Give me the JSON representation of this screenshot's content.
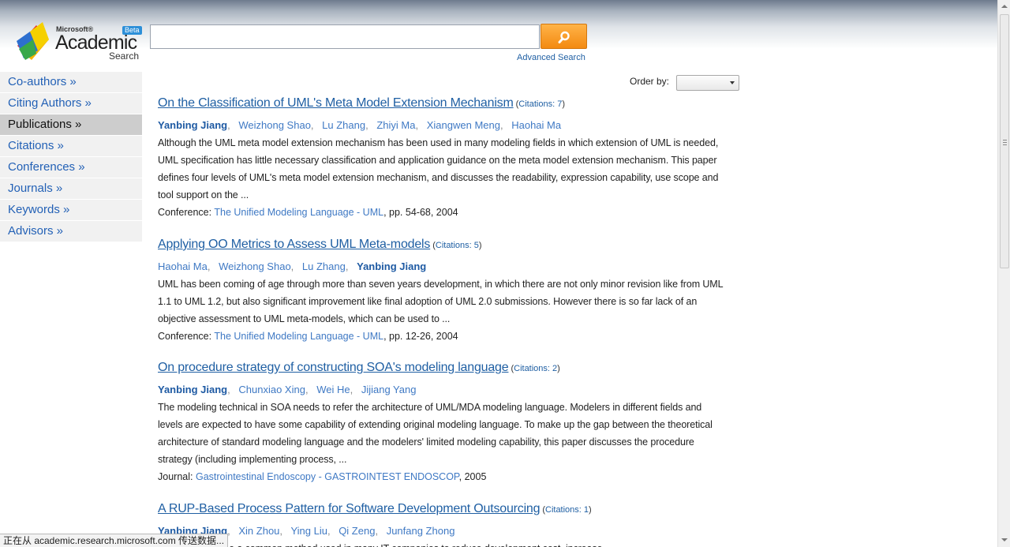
{
  "header": {
    "logo": {
      "microsoft_text": "Microsoft®",
      "academic_text": "Academic",
      "search_text": "Search",
      "beta_text": "Beta"
    },
    "search": {
      "value": "",
      "placeholder": "",
      "button_icon": "search-magnifier-icon"
    },
    "advanced_search": "Advanced Search"
  },
  "sidebar": {
    "items": [
      {
        "label": "Co-authors »",
        "active": false
      },
      {
        "label": "Citing Authors »",
        "active": false
      },
      {
        "label": "Publications »",
        "active": true
      },
      {
        "label": "Citations »",
        "active": false
      },
      {
        "label": "Conferences »",
        "active": false
      },
      {
        "label": "Journals »",
        "active": false
      },
      {
        "label": "Keywords »",
        "active": false
      },
      {
        "label": "Advisors »",
        "active": false
      }
    ]
  },
  "order": {
    "label": "Order by:",
    "selected": ""
  },
  "publications": [
    {
      "title": "On the Classification of UML's Meta Model Extension Mechanism",
      "citations_open": "(",
      "citations": "Citations: 7",
      "citations_close": ")",
      "authors": [
        "Yanbing Jiang",
        "Weizhong Shao",
        "Lu Zhang",
        "Zhiyi Ma",
        "Xiangwen Meng",
        "Haohai Ma"
      ],
      "abstract": "Although the UML meta model extension mechanism has been used in many modeling fields in which extension of UML is needed, UML specification has little necessary classification and application guidance on the meta model extension mechanism. This paper defines four levels of UML's meta model extension mechanism, and discusses the readability, expression capability, use scope and tool support on the ...",
      "venue_label": "Conference:",
      "venue": "The Unified Modeling Language - UML",
      "venue_suffix": ", pp. 54-68, 2004"
    },
    {
      "title": "Applying OO Metrics to Assess UML Meta-models",
      "citations_open": "(",
      "citations": "Citations: 5",
      "citations_close": ")",
      "authors": [
        "Haohai Ma",
        "Weizhong Shao",
        "Lu Zhang",
        "Yanbing Jiang"
      ],
      "abstract": "UML has been coming of age through more than seven years development, in which there are not only minor revision like from UML 1.1 to UML 1.2, but also significant improvement like final adoption of UML 2.0 submissions. However there is so far lack of an objective assessment to UML meta-models, which can be used to ...",
      "venue_label": "Conference:",
      "venue": "The Unified Modeling Language - UML",
      "venue_suffix": ", pp. 12-26, 2004"
    },
    {
      "title": "On procedure strategy of constructing SOA's modeling language",
      "citations_open": "(",
      "citations": "Citations: 2",
      "citations_close": ")",
      "authors": [
        "Yanbing Jiang",
        "Chunxiao Xing",
        "Wei He",
        "Jijiang Yang"
      ],
      "abstract": "The modeling technical in SOA needs to refer the architecture of UML/MDA modeling language. Modelers in different fields and levels are expected to have some capability of extending original modeling language. To make up the gap between the theoretical architecture of standard modeling language and the modelers' limited modeling capability, this paper discusses the procedure strategy (including implementing process, ...",
      "venue_label": "Journal:",
      "venue": "Gastrointestinal Endoscopy - GASTROINTEST ENDOSCOP",
      "venue_suffix": ", 2005"
    },
    {
      "title": "A RUP-Based Process Pattern for Software Development Outsourcing",
      "citations_open": "(",
      "citations": "Citations: 1",
      "citations_close": ")",
      "authors": [
        "Yanbing Jiang",
        "Xin Zhou",
        "Ying Liu",
        "Qi Zeng",
        "Junfang Zhong"
      ],
      "abstract": "...ing has become a common method used in many IT companies to reduce development cost, increase ..."
    }
  ],
  "highlight_author": "Yanbing Jiang",
  "status_bar": "正在从 academic.research.microsoft.com 传送数据...",
  "colors": {
    "link": "#1f5fa3",
    "author": "#3f79c4",
    "active_nav": "#cdcdcd",
    "search_button": "#f38a12"
  }
}
